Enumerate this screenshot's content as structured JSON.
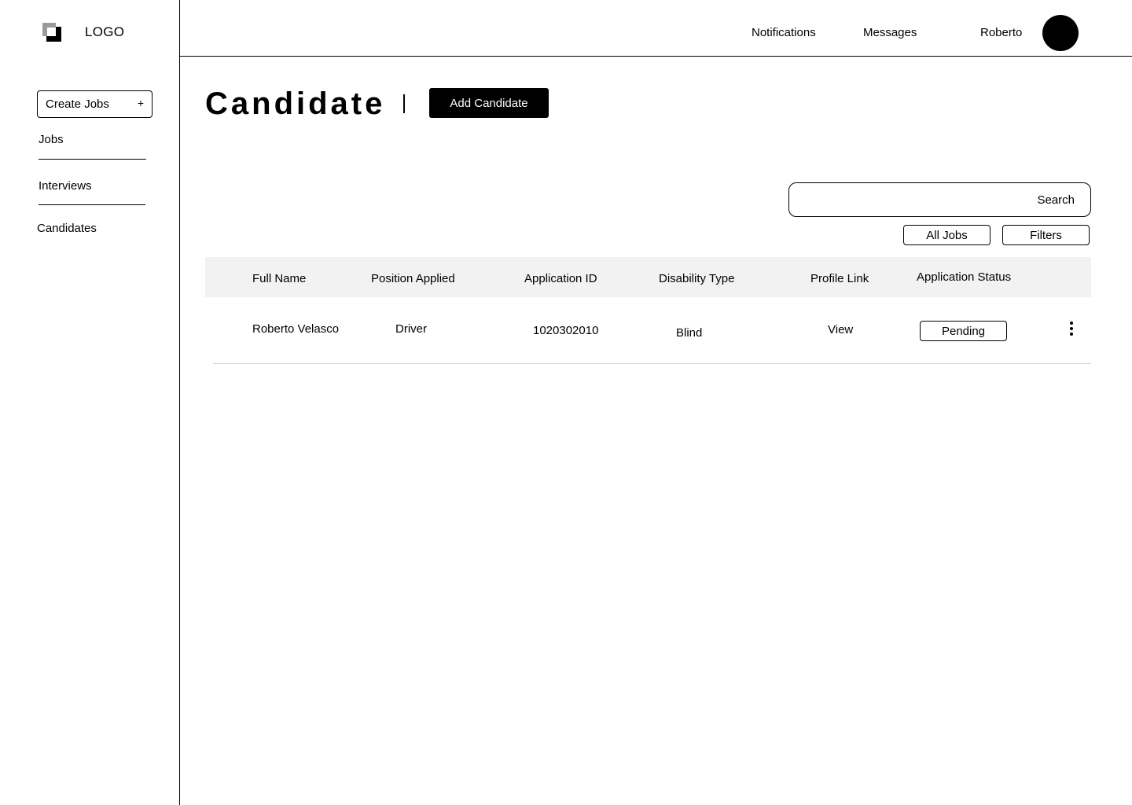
{
  "sidebar": {
    "logo_text": "LOGO",
    "create_jobs_label": "Create Jobs",
    "create_jobs_icon": "+",
    "items": [
      {
        "label": "Jobs"
      },
      {
        "label": "Interviews"
      },
      {
        "label": "Candidates"
      }
    ]
  },
  "header": {
    "notifications": "Notifications",
    "messages": "Messages",
    "user_name": "Roberto"
  },
  "main": {
    "title": "Candidate",
    "add_button_label": "Add Candidate",
    "search_label": "Search",
    "all_jobs_label": "All Jobs",
    "filters_label": "Filters",
    "table": {
      "columns": [
        "Full Name",
        "Position Applied",
        "Application ID",
        "Disability Type",
        "Profile Link",
        "Application Status"
      ],
      "rows": [
        {
          "full_name": "Roberto Velasco",
          "position": "Driver",
          "application_id": "1020302010",
          "disability_type": "Blind",
          "profile_link": "View",
          "status": "Pending"
        }
      ]
    }
  },
  "colors": {
    "accent": "#000000",
    "table_header_bg": "#f2f2f2",
    "background": "#ffffff"
  }
}
